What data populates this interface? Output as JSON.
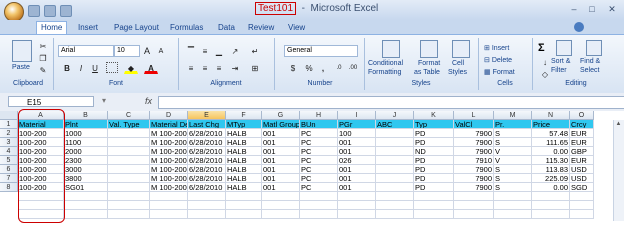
{
  "window": {
    "doc_name": "Test101",
    "app_name": "Microsoft Excel"
  },
  "tabs": [
    "Home",
    "Insert",
    "Page Layout",
    "Formulas",
    "Data",
    "Review",
    "View"
  ],
  "ribbon": {
    "clipboard": {
      "paste": "Paste",
      "label": "Clipboard"
    },
    "font": {
      "name": "Arial",
      "size": "10",
      "label": "Font"
    },
    "alignment": {
      "label": "Alignment"
    },
    "number": {
      "format": "General",
      "currency": "$",
      "percent": "%",
      "comma": ",",
      "label": "Number"
    },
    "styles": {
      "conditional": "Conditional",
      "formatting": "Formatting",
      "format_as": "Format",
      "as_table": "as Table",
      "cell": "Cell",
      "cell_styles": "Styles",
      "label": "Styles"
    },
    "cells": {
      "insert": "Insert",
      "delete": "Delete",
      "format": "Format",
      "label": "Cells"
    },
    "editing": {
      "sum": "Σ",
      "sort": "Sort &",
      "filter": "Filter",
      "find": "Find &",
      "select": "Select",
      "label": "Editing"
    }
  },
  "formula_bar": {
    "name_box": "E15",
    "fx": "fx",
    "content": ""
  },
  "grid": {
    "columns": [
      "A",
      "B",
      "C",
      "D",
      "E",
      "F",
      "G",
      "H",
      "I",
      "J",
      "K",
      "L",
      "M",
      "N",
      "O"
    ],
    "selected_column": "E",
    "rows": [
      "1",
      "2",
      "3",
      "4",
      "5",
      "6",
      "7",
      "8"
    ],
    "header_row": [
      "Material",
      "Plnt",
      "Val. Type",
      "Material Des",
      "Last Chg",
      "MTyp",
      "Matl Group",
      "BUn",
      "PGr",
      "ABC",
      "Typ",
      "ValCl",
      "Pr.",
      "Price",
      "Crcy"
    ],
    "data": [
      [
        "100-200",
        "1000",
        "",
        "M 100-200",
        "6/28/2010",
        "HALB",
        "001",
        "PC",
        "100",
        "",
        "PD",
        "7900",
        "S",
        "57.48",
        "EUR"
      ],
      [
        "100-200",
        "1100",
        "",
        "M 100-200",
        "6/28/2010",
        "HALB",
        "001",
        "PC",
        "001",
        "",
        "PD",
        "7900",
        "S",
        "111.65",
        "EUR"
      ],
      [
        "100-200",
        "2000",
        "",
        "M 100-200",
        "6/28/2010",
        "HALB",
        "001",
        "PC",
        "001",
        "",
        "ND",
        "7900",
        "V",
        "0.00",
        "GBP"
      ],
      [
        "100-200",
        "2300",
        "",
        "M 100-200",
        "6/28/2010",
        "HALB",
        "001",
        "PC",
        "026",
        "",
        "PD",
        "7910",
        "V",
        "115.30",
        "EUR"
      ],
      [
        "100-200",
        "3000",
        "",
        "M 100-200",
        "6/28/2010",
        "HALB",
        "001",
        "PC",
        "001",
        "",
        "PD",
        "7900",
        "S",
        "113.83",
        "USD"
      ],
      [
        "100-200",
        "3800",
        "",
        "M 100-200",
        "6/28/2010",
        "HALB",
        "001",
        "PC",
        "001",
        "",
        "PD",
        "7900",
        "S",
        "225.09",
        "USD"
      ],
      [
        "100-200",
        "SG01",
        "",
        "M 100-200",
        "6/28/2010",
        "HALB",
        "001",
        "PC",
        "001",
        "",
        "PD",
        "7900",
        "S",
        "0.00",
        "SGD"
      ]
    ]
  },
  "colors": {
    "header_fill": "#2fc7ef",
    "highlight": "#cc0000"
  }
}
